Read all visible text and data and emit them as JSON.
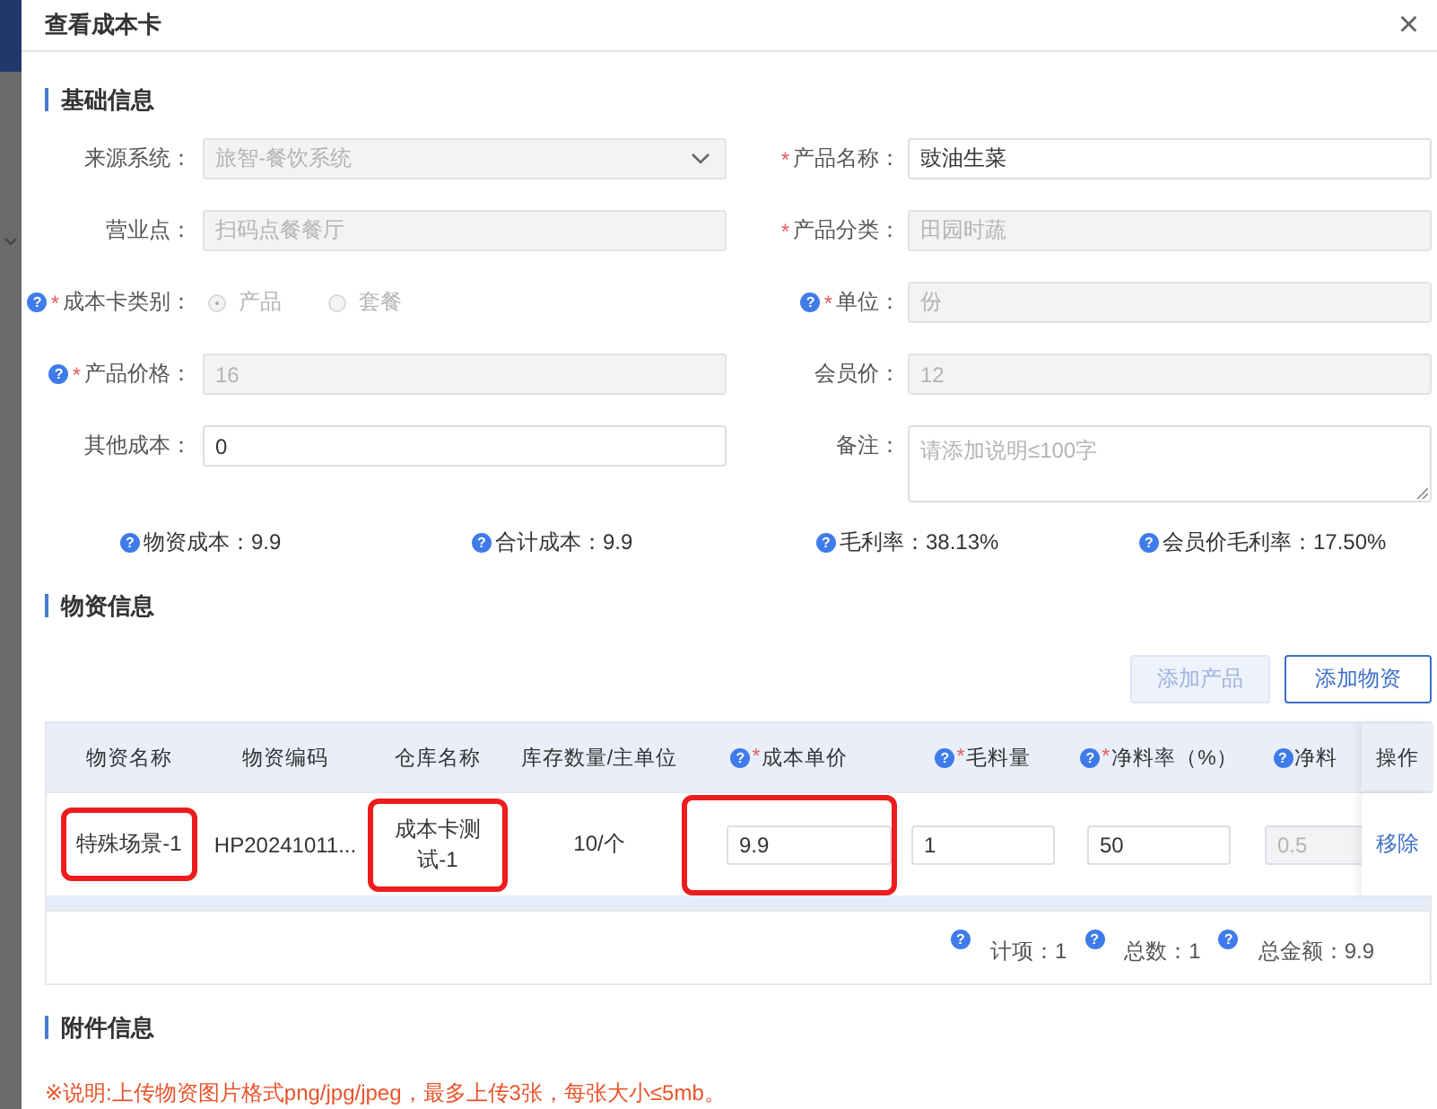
{
  "dialog": {
    "title": "查看成本卡",
    "close_icon": "×"
  },
  "basic_info": {
    "heading": "基础信息",
    "fields": [
      {
        "kind": "select",
        "label": "来源系统：",
        "value": "旅智-餐饮系统",
        "disabled": true
      },
      {
        "kind": "input",
        "label": "产品名称：",
        "required": "*",
        "value": "豉油生菜",
        "disabled": false
      },
      {
        "kind": "input",
        "label": "营业点：",
        "value": "扫码点餐餐厅",
        "disabled": true
      },
      {
        "kind": "input",
        "label": "产品分类：",
        "required": "*",
        "value": "田园时蔬",
        "disabled": true
      },
      {
        "kind": "radio",
        "label": "成本卡类别：",
        "required": "*",
        "help": "?",
        "disabled": true,
        "options": [
          {
            "label": "产品",
            "selected": true
          },
          {
            "label": "套餐",
            "selected": false
          }
        ]
      },
      {
        "kind": "input",
        "label": "单位：",
        "required": "*",
        "help": "?",
        "value": "份",
        "disabled": true
      },
      {
        "kind": "input",
        "label": "产品价格：",
        "required": "*",
        "help": "?",
        "value": "16",
        "disabled": true
      },
      {
        "kind": "input",
        "label": "会员价：",
        "value": "12",
        "disabled": true
      },
      {
        "kind": "input",
        "label": "其他成本：",
        "value": "0",
        "disabled": false
      },
      {
        "kind": "textarea",
        "label": "备注：",
        "placeholder": "请添加说明≤100字",
        "disabled": false
      }
    ],
    "summary": [
      {
        "help": "?",
        "text": "物资成本：9.9"
      },
      {
        "help": "?",
        "text": "合计成本：9.9"
      },
      {
        "help": "?",
        "text": "毛利率：38.13%"
      },
      {
        "help": "?",
        "text": "会员价毛利率：17.50%"
      }
    ]
  },
  "materials": {
    "heading": "物资信息",
    "buttons": [
      {
        "label": "添加产品",
        "disabled": true
      },
      {
        "label": "添加物资",
        "disabled": false
      }
    ],
    "columns": [
      {
        "label": "物资名称"
      },
      {
        "label": "物资编码"
      },
      {
        "label": "仓库名称"
      },
      {
        "label": "库存数量/主单位"
      },
      {
        "label": "成本单价",
        "help": "?",
        "required": "*"
      },
      {
        "label": "毛料量",
        "help": "?",
        "required": "*"
      },
      {
        "label": "净料率（%）",
        "help": "?",
        "required": "*"
      },
      {
        "label": "净料",
        "help": "?"
      },
      {
        "label": "操作"
      }
    ],
    "rows": [
      {
        "cells": [
          {
            "kind": "text",
            "value": "特殊场景-1",
            "highlighted": true
          },
          {
            "kind": "text",
            "value": "HP20241011...",
            "highlighted": false
          },
          {
            "kind": "text",
            "value": "成本卡测试-1",
            "highlighted": true
          },
          {
            "kind": "text",
            "value": "10/个",
            "highlighted": false
          },
          {
            "kind": "input",
            "value": "9.9",
            "disabled": false,
            "highlighted": true
          },
          {
            "kind": "input",
            "value": "1",
            "disabled": false,
            "highlighted": false
          },
          {
            "kind": "input",
            "value": "50",
            "disabled": false,
            "highlighted": false
          },
          {
            "kind": "input",
            "value": "0.5",
            "disabled": true,
            "highlighted": false
          },
          {
            "kind": "link",
            "value": "移除",
            "highlighted": false
          }
        ]
      }
    ],
    "footer": [
      {
        "help": "?",
        "text": "计项：1"
      },
      {
        "help": "?",
        "text": "总数：1"
      },
      {
        "help": "?",
        "text": "总金额：9.9"
      }
    ]
  },
  "attachments": {
    "heading": "附件信息",
    "note": "※说明:上传物资图片格式png/jpg/jpeg，最多上传3张，每张大小≤5mb。"
  }
}
